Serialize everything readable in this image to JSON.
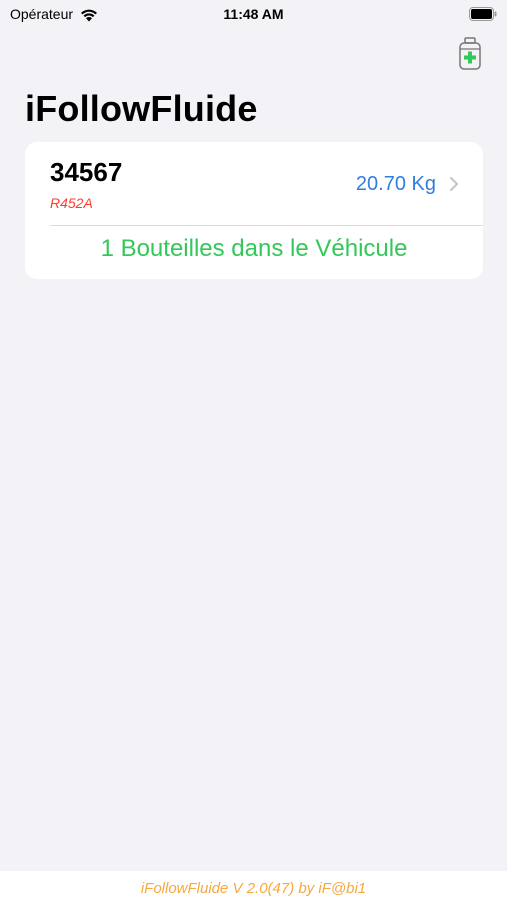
{
  "status_bar": {
    "carrier": "Opérateur",
    "time": "11:48 AM",
    "wifi_icon": "wifi-icon",
    "battery_icon": "battery-full-icon"
  },
  "nav": {
    "title": "iFollowFluide",
    "action_icon": "add-bottle-icon",
    "action_icon_color": "#34c759"
  },
  "bottles": [
    {
      "id": "34567",
      "fluid": "R452A",
      "weight": "20.70 Kg"
    }
  ],
  "summary": "1 Bouteilles dans le Véhicule",
  "footer": {
    "version_text": "iFollowFluide V 2.0(47) by iF@bi1"
  },
  "colors": {
    "background": "#f2f2f7",
    "weight": "#2f7fde",
    "fluid": "#ff3b30",
    "summary": "#34c759",
    "footer_text": "#f7a83e"
  }
}
